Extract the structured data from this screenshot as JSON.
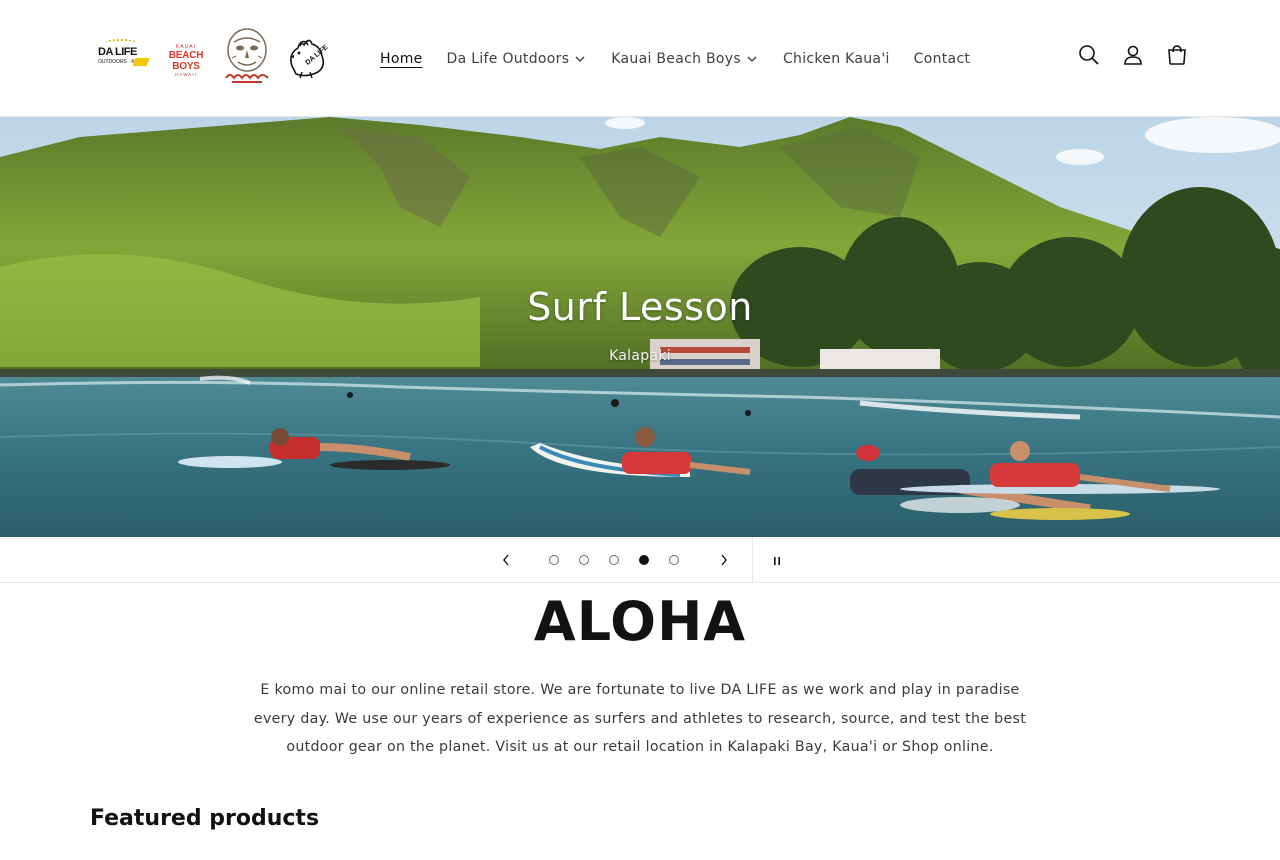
{
  "header": {
    "logos": {
      "dalife_text": "DA LIFE",
      "dalife_sub": "OUTDOORS · KAUAI",
      "kbb_top": "KAUAI",
      "kbb_main": "BEACH BOYS",
      "kbb_bottom": "HAWAII",
      "chicken_text": "DA LIFE"
    },
    "nav": [
      {
        "label": "Home",
        "active": true
      },
      {
        "label": "Da Life Outdoors",
        "dropdown": true
      },
      {
        "label": "Kauai Beach Boys",
        "dropdown": true
      },
      {
        "label": "Chicken Kaua'i"
      },
      {
        "label": "Contact"
      }
    ],
    "icons": [
      "search-icon",
      "account-icon",
      "cart-icon"
    ]
  },
  "hero": {
    "title": "Surf Lesson",
    "subtitle": "Kalapaki",
    "slide_count": 5,
    "active_slide": 4
  },
  "aloha": {
    "heading": "ALOHA",
    "text": "E komo mai to our online retail store. We are fortunate to live DA LIFE as we work and play in paradise every day.  We use our years of experience as surfers and athletes to research, source, and test the best outdoor gear on the planet.  Visit us at our retail location in Kalapaki Bay, Kaua'i or Shop online."
  },
  "featured": {
    "heading": "Featured products"
  }
}
